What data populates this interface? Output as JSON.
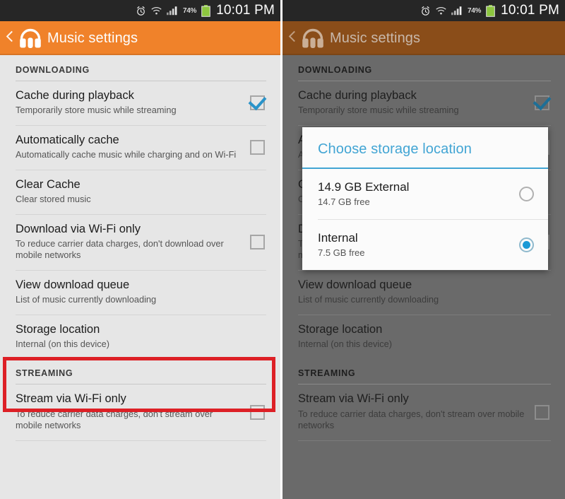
{
  "status_bar": {
    "alarm_icon": "alarm-clock-icon",
    "wifi_icon": "wifi-icon",
    "signal_icon": "cellular-signal-icon",
    "battery_percent": "74%",
    "battery_icon": "battery-icon",
    "clock": "10:01 PM"
  },
  "action_bar": {
    "back_icon": "back-chevron-icon",
    "app_icon": "headphones-icon",
    "title": "Music settings"
  },
  "colors": {
    "accent_orange": "#f0822a",
    "accent_orange_dim": "#8a4d19",
    "dialog_blue": "#42a5d4",
    "radio_blue": "#1b9ad6",
    "checkbox_blue": "#2a93c9",
    "highlight_red": "#dd2026",
    "list_background": "#e6e6e6",
    "list_background_dim": "#6a6a6a",
    "status_bar": "#262626"
  },
  "sections": [
    {
      "header": "DOWNLOADING",
      "rows": [
        {
          "title": "Cache during playback",
          "subtitle": "Temporarily store music while streaming",
          "control": "checkbox",
          "checked": true
        },
        {
          "title": "Automatically cache",
          "subtitle": "Automatically cache music while charging and on Wi-Fi",
          "control": "checkbox",
          "checked": false
        },
        {
          "title": "Clear Cache",
          "subtitle": "Clear stored music",
          "control": "none",
          "checked": false
        },
        {
          "title": "Download via Wi-Fi only",
          "subtitle": "To reduce carrier data charges, don't download over mobile networks",
          "control": "checkbox",
          "checked": false
        },
        {
          "title": "View download queue",
          "subtitle": "List of music currently downloading",
          "control": "none",
          "checked": false
        },
        {
          "title": "Storage location",
          "subtitle": "Internal (on this device)",
          "control": "none",
          "checked": false,
          "highlighted": true
        }
      ]
    },
    {
      "header": "STREAMING",
      "rows": [
        {
          "title": "Stream via Wi-Fi only",
          "subtitle": "To reduce carrier data charges, don't stream over mobile networks",
          "control": "checkbox",
          "checked": false
        }
      ]
    }
  ],
  "dialog": {
    "title": "Choose storage location",
    "options": [
      {
        "title": "14.9 GB External",
        "subtitle": "14.7 GB free",
        "selected": false
      },
      {
        "title": "Internal",
        "subtitle": "7.5 GB free",
        "selected": true
      }
    ]
  }
}
